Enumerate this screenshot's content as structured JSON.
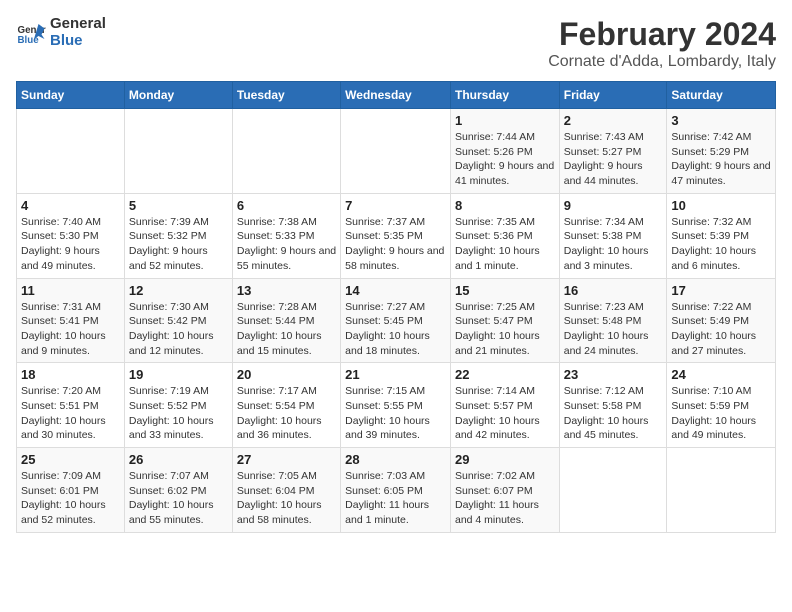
{
  "logo": {
    "text_general": "General",
    "text_blue": "Blue"
  },
  "title": "February 2024",
  "subtitle": "Cornate d'Adda, Lombardy, Italy",
  "days_of_week": [
    "Sunday",
    "Monday",
    "Tuesday",
    "Wednesday",
    "Thursday",
    "Friday",
    "Saturday"
  ],
  "weeks": [
    [
      {
        "day": "",
        "info": ""
      },
      {
        "day": "",
        "info": ""
      },
      {
        "day": "",
        "info": ""
      },
      {
        "day": "",
        "info": ""
      },
      {
        "day": "1",
        "info": "Sunrise: 7:44 AM\nSunset: 5:26 PM\nDaylight: 9 hours and 41 minutes."
      },
      {
        "day": "2",
        "info": "Sunrise: 7:43 AM\nSunset: 5:27 PM\nDaylight: 9 hours and 44 minutes."
      },
      {
        "day": "3",
        "info": "Sunrise: 7:42 AM\nSunset: 5:29 PM\nDaylight: 9 hours and 47 minutes."
      }
    ],
    [
      {
        "day": "4",
        "info": "Sunrise: 7:40 AM\nSunset: 5:30 PM\nDaylight: 9 hours and 49 minutes."
      },
      {
        "day": "5",
        "info": "Sunrise: 7:39 AM\nSunset: 5:32 PM\nDaylight: 9 hours and 52 minutes."
      },
      {
        "day": "6",
        "info": "Sunrise: 7:38 AM\nSunset: 5:33 PM\nDaylight: 9 hours and 55 minutes."
      },
      {
        "day": "7",
        "info": "Sunrise: 7:37 AM\nSunset: 5:35 PM\nDaylight: 9 hours and 58 minutes."
      },
      {
        "day": "8",
        "info": "Sunrise: 7:35 AM\nSunset: 5:36 PM\nDaylight: 10 hours and 1 minute."
      },
      {
        "day": "9",
        "info": "Sunrise: 7:34 AM\nSunset: 5:38 PM\nDaylight: 10 hours and 3 minutes."
      },
      {
        "day": "10",
        "info": "Sunrise: 7:32 AM\nSunset: 5:39 PM\nDaylight: 10 hours and 6 minutes."
      }
    ],
    [
      {
        "day": "11",
        "info": "Sunrise: 7:31 AM\nSunset: 5:41 PM\nDaylight: 10 hours and 9 minutes."
      },
      {
        "day": "12",
        "info": "Sunrise: 7:30 AM\nSunset: 5:42 PM\nDaylight: 10 hours and 12 minutes."
      },
      {
        "day": "13",
        "info": "Sunrise: 7:28 AM\nSunset: 5:44 PM\nDaylight: 10 hours and 15 minutes."
      },
      {
        "day": "14",
        "info": "Sunrise: 7:27 AM\nSunset: 5:45 PM\nDaylight: 10 hours and 18 minutes."
      },
      {
        "day": "15",
        "info": "Sunrise: 7:25 AM\nSunset: 5:47 PM\nDaylight: 10 hours and 21 minutes."
      },
      {
        "day": "16",
        "info": "Sunrise: 7:23 AM\nSunset: 5:48 PM\nDaylight: 10 hours and 24 minutes."
      },
      {
        "day": "17",
        "info": "Sunrise: 7:22 AM\nSunset: 5:49 PM\nDaylight: 10 hours and 27 minutes."
      }
    ],
    [
      {
        "day": "18",
        "info": "Sunrise: 7:20 AM\nSunset: 5:51 PM\nDaylight: 10 hours and 30 minutes."
      },
      {
        "day": "19",
        "info": "Sunrise: 7:19 AM\nSunset: 5:52 PM\nDaylight: 10 hours and 33 minutes."
      },
      {
        "day": "20",
        "info": "Sunrise: 7:17 AM\nSunset: 5:54 PM\nDaylight: 10 hours and 36 minutes."
      },
      {
        "day": "21",
        "info": "Sunrise: 7:15 AM\nSunset: 5:55 PM\nDaylight: 10 hours and 39 minutes."
      },
      {
        "day": "22",
        "info": "Sunrise: 7:14 AM\nSunset: 5:57 PM\nDaylight: 10 hours and 42 minutes."
      },
      {
        "day": "23",
        "info": "Sunrise: 7:12 AM\nSunset: 5:58 PM\nDaylight: 10 hours and 45 minutes."
      },
      {
        "day": "24",
        "info": "Sunrise: 7:10 AM\nSunset: 5:59 PM\nDaylight: 10 hours and 49 minutes."
      }
    ],
    [
      {
        "day": "25",
        "info": "Sunrise: 7:09 AM\nSunset: 6:01 PM\nDaylight: 10 hours and 52 minutes."
      },
      {
        "day": "26",
        "info": "Sunrise: 7:07 AM\nSunset: 6:02 PM\nDaylight: 10 hours and 55 minutes."
      },
      {
        "day": "27",
        "info": "Sunrise: 7:05 AM\nSunset: 6:04 PM\nDaylight: 10 hours and 58 minutes."
      },
      {
        "day": "28",
        "info": "Sunrise: 7:03 AM\nSunset: 6:05 PM\nDaylight: 11 hours and 1 minute."
      },
      {
        "day": "29",
        "info": "Sunrise: 7:02 AM\nSunset: 6:07 PM\nDaylight: 11 hours and 4 minutes."
      },
      {
        "day": "",
        "info": ""
      },
      {
        "day": "",
        "info": ""
      }
    ]
  ]
}
